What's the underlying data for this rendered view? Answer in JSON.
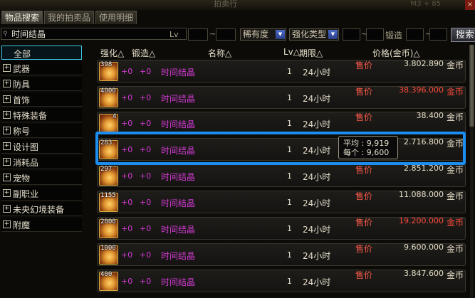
{
  "window": {
    "title": "拍卖行",
    "hint": "M3 + 85",
    "close_label": "×"
  },
  "tabs": [
    {
      "label": "物品搜索",
      "active": true
    },
    {
      "label": "我的拍卖品",
      "active": false
    },
    {
      "label": "使用明细",
      "active": false
    }
  ],
  "filters": {
    "search_value": "时间结晶",
    "lv_label": "Lv",
    "rarity_label": "稀有度",
    "enhance_label": "强化类型",
    "forge_label": "锻造",
    "tilde": "~",
    "search_button": "搜索"
  },
  "categories": [
    {
      "label": "全部",
      "active": true,
      "toggle": ""
    },
    {
      "label": "武器",
      "toggle": "+"
    },
    {
      "label": "防具",
      "toggle": "+"
    },
    {
      "label": "首饰",
      "toggle": "+"
    },
    {
      "label": "特殊装备",
      "toggle": "+"
    },
    {
      "label": "称号",
      "toggle": "+"
    },
    {
      "label": "设计图",
      "toggle": "+"
    },
    {
      "label": "消耗品",
      "toggle": "+"
    },
    {
      "label": "宠物",
      "toggle": "+"
    },
    {
      "label": "副职业",
      "toggle": "+"
    },
    {
      "label": "未央幻境装备",
      "toggle": "+"
    },
    {
      "label": "附魔",
      "toggle": "+"
    }
  ],
  "columns": {
    "enhance": "强化△",
    "forge": "锻造△",
    "name": "名称△",
    "lv": "Lv△",
    "duration": "期限△",
    "price": "价格(金币)△"
  },
  "rows": [
    {
      "qty": "398",
      "enh": "+0",
      "ref": "+0",
      "name": "时间结晶",
      "lv": "1",
      "dur": "24小时",
      "sale": "售价",
      "price": "3.802.890",
      "unit": "金币",
      "red": false
    },
    {
      "qty": "4000",
      "enh": "+0",
      "ref": "+0",
      "name": "时间结晶",
      "lv": "1",
      "dur": "24小时",
      "sale": "售价",
      "price": "38.396.000",
      "unit": "金币",
      "red": true
    },
    {
      "qty": "4",
      "enh": "+0",
      "ref": "+0",
      "name": "时间结晶",
      "lv": "1",
      "dur": "24小时",
      "sale": "售价",
      "price": "38.400",
      "unit": "金币",
      "red": false
    },
    {
      "qty": "283",
      "enh": "+0",
      "ref": "+0",
      "name": "时间结晶",
      "lv": "1",
      "dur": "24小时",
      "sale": "售价",
      "price": "2.716.800",
      "unit": "金币",
      "red": false
    },
    {
      "qty": "297",
      "enh": "+0",
      "ref": "+0",
      "name": "时间结晶",
      "lv": "1",
      "dur": "24小时",
      "sale": "售价",
      "price": "2.851.200",
      "unit": "金币",
      "red": false
    },
    {
      "qty": "1155",
      "enh": "+0",
      "ref": "+0",
      "name": "时间结晶",
      "lv": "1",
      "dur": "24小时",
      "sale": "售价",
      "price": "11.088.000",
      "unit": "金币",
      "red": false
    },
    {
      "qty": "2000",
      "enh": "+0",
      "ref": "+0",
      "name": "时间结晶",
      "lv": "1",
      "dur": "24小时",
      "sale": "售价",
      "price": "19.200.000",
      "unit": "金币",
      "red": true
    },
    {
      "qty": "1000",
      "enh": "+0",
      "ref": "+0",
      "name": "时间结晶",
      "lv": "1",
      "dur": "24小时",
      "sale": "售价",
      "price": "9.600.000",
      "unit": "金币",
      "red": false
    },
    {
      "qty": "400",
      "enh": "+0",
      "ref": "+0",
      "name": "时间结晶",
      "lv": "1",
      "dur": "24小时",
      "sale": "售价",
      "price": "3.847.600",
      "unit": "金币",
      "red": false
    }
  ],
  "tooltip": {
    "line1": "平均 : 9,919",
    "line2": "每个 : 9,600"
  },
  "colors": {
    "highlight": "#1b8ef0",
    "item_text": "#d33ad3",
    "sale_text": "#ff5a4a",
    "expensive_price": "#ff4a3a"
  }
}
